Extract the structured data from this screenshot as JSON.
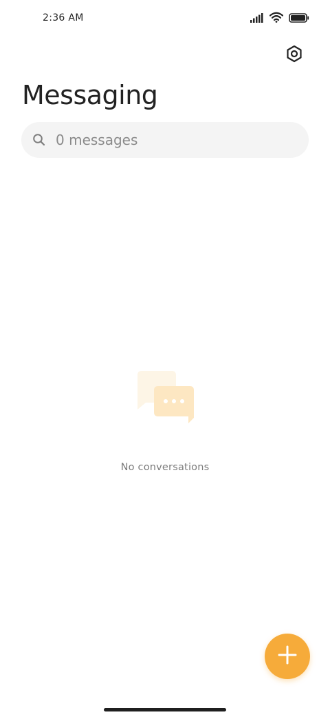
{
  "status_bar": {
    "time": "2:36 AM",
    "icons": [
      "signal-icon",
      "wifi-icon",
      "battery-icon"
    ]
  },
  "header": {
    "title": "Messaging",
    "settings_icon": "settings-icon"
  },
  "search": {
    "placeholder": "0 messages",
    "icon": "search-icon"
  },
  "empty_state": {
    "illustration": "chat-bubbles-icon",
    "message": "No conversations"
  },
  "fab": {
    "icon": "plus-icon"
  },
  "colors": {
    "accent": "#f6ab3a",
    "illustration_back": "#fdf3e2",
    "illustration_front": "#fde6bf",
    "search_bg": "#f4f4f4",
    "text_primary": "#222222",
    "text_secondary": "#7a7a7a"
  }
}
